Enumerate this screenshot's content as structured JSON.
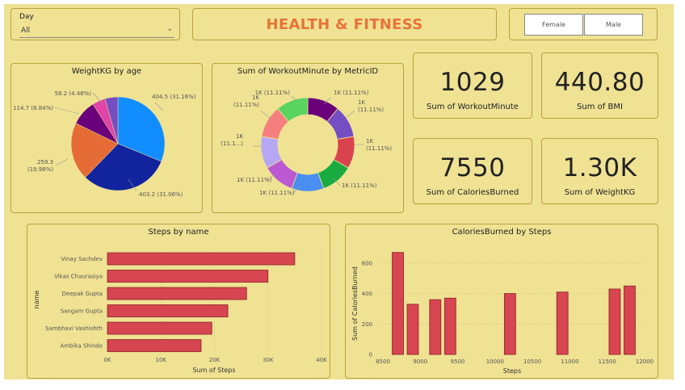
{
  "slicer": {
    "label": "Day",
    "value": "All"
  },
  "header": {
    "title": "HEALTH & FITNESS"
  },
  "gender": {
    "female": "Female",
    "male": "Male"
  },
  "kpis": [
    {
      "value": "1029",
      "label": "Sum of WorkoutMinute"
    },
    {
      "value": "440.80",
      "label": "Sum of BMI"
    },
    {
      "value": "7550",
      "label": "Sum of CaloriesBurned"
    },
    {
      "value": "1.30K",
      "label": "Sum of WeightKG"
    }
  ],
  "colors": {
    "accent": "#e8733a",
    "canvas": "#efe293",
    "bar": "#d64550",
    "border": "#b9a23a"
  },
  "chart_data": [
    {
      "type": "pie",
      "title": "WeightKG by age",
      "slices": [
        {
          "value": 404.5,
          "label": "404.5 (31.16%)",
          "color": "#118dff"
        },
        {
          "value": 403.2,
          "label": "403.2 (31.06%)",
          "color": "#12239e"
        },
        {
          "value": 259.3,
          "label": "259.3 (19.98%)",
          "color": "#e66c37"
        },
        {
          "value": 114.7,
          "label": "114.7 (8.84%)",
          "color": "#6b007b"
        },
        {
          "value": 58.2,
          "label": "58.2 (4.48%)",
          "color": "#e044a7"
        },
        {
          "value": 58.1,
          "label": "",
          "color": "#744ec2"
        }
      ]
    },
    {
      "type": "pie",
      "title": "Sum of WorkoutMinute by MetricID",
      "donut": true,
      "slices": [
        {
          "value": 1,
          "label": "1K (11.11%)",
          "color": "#6b007b"
        },
        {
          "value": 1,
          "label": "1K (11.11%)",
          "color": "#744ec2"
        },
        {
          "value": 1,
          "label": "1K (11.11%)",
          "color": "#d9434f"
        },
        {
          "value": 1,
          "label": "1K (11.11%)",
          "color": "#1aab40"
        },
        {
          "value": 1,
          "label": "1K (11.11%)",
          "color": "#4a8ff0"
        },
        {
          "value": 1,
          "label": "1K (11.11%)",
          "color": "#bb58d2"
        },
        {
          "value": 1,
          "label": "1K (11.1...)",
          "color": "#b6a7f5"
        },
        {
          "value": 1,
          "label": "1K (11.11%)",
          "color": "#f57f7f"
        },
        {
          "value": 1,
          "label": "1K (11.11%)",
          "color": "#59d45f"
        }
      ]
    },
    {
      "type": "bar",
      "title": "Steps by name",
      "orientation": "horizontal",
      "categories": [
        "Vinay Sachdev",
        "Vikas Chaurasiya",
        "Deepak Gupta",
        "Sangam Gupta",
        "Sambhavi Vashishth",
        "Ambika Shinde"
      ],
      "values": [
        35000,
        30000,
        26000,
        22500,
        19500,
        17500
      ],
      "xlabel": "Sum of Steps",
      "ylabel": "name",
      "xlim": [
        0,
        40000
      ],
      "xticks": [
        "0K",
        "10K",
        "20K",
        "30K",
        "40K"
      ]
    },
    {
      "type": "bar",
      "title": "CaloriesBurned by Steps",
      "x": [
        8700,
        8900,
        9200,
        9400,
        10200,
        10900,
        11600,
        11800
      ],
      "values": [
        670,
        330,
        360,
        370,
        400,
        410,
        430,
        450
      ],
      "xlabel": "Steps",
      "ylabel": "Sum of CaloriesBurned",
      "xlim": [
        8500,
        12000
      ],
      "ylim": [
        0,
        700
      ],
      "xticks": [
        "8500",
        "9000",
        "9500",
        "10000",
        "10500",
        "11000",
        "11500",
        "12000"
      ],
      "yticks": [
        "0",
        "200",
        "400",
        "600"
      ]
    }
  ]
}
